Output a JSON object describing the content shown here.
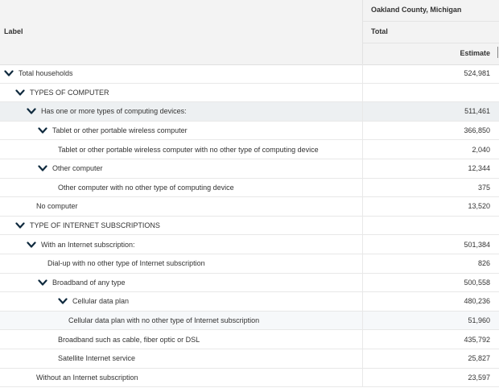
{
  "header": {
    "label": "Label",
    "geography": "Oakland County, Michigan",
    "total": "Total",
    "estimate": "Estimate"
  },
  "rows": [
    {
      "label": "Total households",
      "value": "524,981",
      "level": 0,
      "expandable": true
    },
    {
      "label": "TYPES OF COMPUTER",
      "value": "",
      "level": 1,
      "expandable": true
    },
    {
      "label": "Has one or more types of computing devices:",
      "value": "511,461",
      "level": 2,
      "expandable": true
    },
    {
      "label": "Tablet or other portable wireless computer",
      "value": "366,850",
      "level": 3,
      "expandable": true
    },
    {
      "label": "Tablet or other portable wireless computer with no other type of computing device",
      "value": "2,040",
      "level": 4,
      "expandable": false
    },
    {
      "label": "Other computer",
      "value": "12,344",
      "level": 3,
      "expandable": true
    },
    {
      "label": "Other computer with no other type of computing device",
      "value": "375",
      "level": 4,
      "expandable": false
    },
    {
      "label": "No computer",
      "value": "13,520",
      "level": 2,
      "expandable": false
    },
    {
      "label": "TYPE OF INTERNET SUBSCRIPTIONS",
      "value": "",
      "level": 1,
      "expandable": true
    },
    {
      "label": "With an Internet subscription:",
      "value": "501,384",
      "level": 2,
      "expandable": true
    },
    {
      "label": "Dial-up with no other type of Internet subscription",
      "value": "826",
      "level": 3,
      "expandable": false
    },
    {
      "label": "Broadband of any type",
      "value": "500,558",
      "level": 3,
      "expandable": true
    },
    {
      "label": "Cellular data plan",
      "value": "480,236",
      "level": 4,
      "expandable": true
    },
    {
      "label": "Cellular data plan with no other type of Internet subscription",
      "value": "51,960",
      "level": 5,
      "expandable": false
    },
    {
      "label": "Broadband such as cable, fiber optic or DSL",
      "value": "435,792",
      "level": 4,
      "expandable": false
    },
    {
      "label": "Satellite Internet service",
      "value": "25,827",
      "level": 4,
      "expandable": false
    },
    {
      "label": "Without an Internet subscription",
      "value": "23,597",
      "level": 2,
      "expandable": false
    }
  ],
  "highlighted_row": 2,
  "subtle_row": 13
}
